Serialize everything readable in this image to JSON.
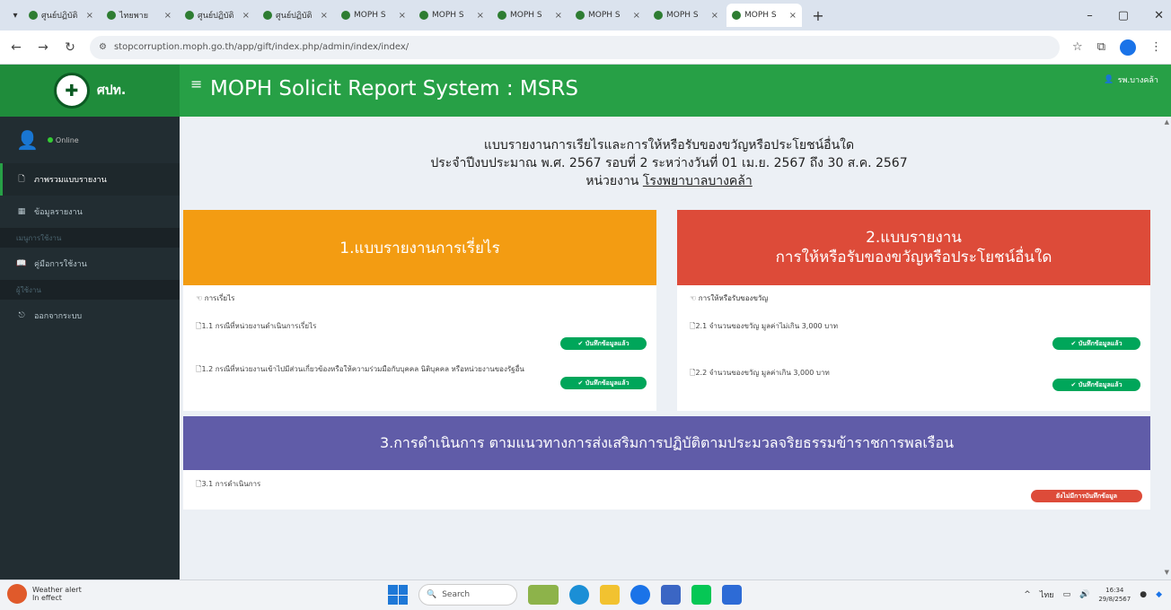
{
  "browser": {
    "tabs": [
      {
        "label": "ศูนย์ปฏิบัติ"
      },
      {
        "label": "ไทยพาย"
      },
      {
        "label": "ศูนย์ปฏิบัติ"
      },
      {
        "label": "ศูนย์ปฏิบัติ"
      },
      {
        "label": "MOPH S"
      },
      {
        "label": "MOPH S"
      },
      {
        "label": "MOPH S"
      },
      {
        "label": "MOPH S"
      },
      {
        "label": "MOPH S"
      },
      {
        "label": "MOPH S"
      }
    ],
    "url": "stopcorruption.moph.go.th/app/gift/index.php/admin/index/index/"
  },
  "app": {
    "logo_text": "ศปท.",
    "title": "MOPH Solicit Report System : MSRS",
    "user_name": "รพ.บางคล้า"
  },
  "sidebar": {
    "status": "Online",
    "items": [
      {
        "label": "ภาพรวมแบบรายงาน",
        "icon": "file-icon"
      },
      {
        "label": "ข้อมูลรายงาน",
        "icon": "table-icon"
      },
      {
        "header": "เมนูการใช้งาน"
      },
      {
        "label": "คู่มือการใช้งาน",
        "icon": "book-icon"
      },
      {
        "header": "ผู้ใช้งาน"
      },
      {
        "label": "ออกจากระบบ",
        "icon": "logout-icon"
      }
    ]
  },
  "header": {
    "line1": "แบบรายงานการเรียไรและการให้หรือรับของขวัญหรือประโยชน์อื่นใด",
    "line2": "ประจำปีงบประมาณ พ.ศ. 2567 รอบที่ 2 ระหว่างวันที่ 01 เม.ย. 2567 ถึง 30 ส.ค. 2567",
    "unit_prefix": "หน่วยงาน",
    "unit_name": "โรงพยาบาลบางคล้า"
  },
  "panels": [
    {
      "title": "1.แบบรายงานการเรี่ยไร",
      "subtitle": "การเรี่ยไร",
      "rows": [
        {
          "text": "1.1 กรณีที่หน่วยงานดำเนินการเรี่ยไร",
          "badge": "บันทึกข้อมูลแล้ว"
        },
        {
          "text": "1.2 กรณีที่หน่วยงานเข้าไปมีส่วนเกี่ยวข้องหรือให้ความร่วมมือกับบุคคล นิติบุคคล หรือหน่วยงานของรัฐอื่น",
          "badge": "บันทึกข้อมูลแล้ว"
        }
      ]
    },
    {
      "title_line1": "2.แบบรายงาน",
      "title_line2": "การให้หรือรับของขวัญหรือประโยชน์อื่นใด",
      "subtitle": "การให้หรือรับของขวัญ",
      "rows": [
        {
          "text": "2.1 จำนวนของขวัญ มูลค่าไม่เกิน 3,000 บาท",
          "badge": "บันทึกข้อมูลแล้ว"
        },
        {
          "text": "2.2 จำนวนของขวัญ มูลค่าเกิน 3,000 บาท",
          "badge": "บันทึกข้อมูลแล้ว"
        }
      ]
    },
    {
      "title": "3.การดำเนินการ ตามแนวทางการส่งเสริมการปฏิบัติตามประมวลจริยธรรมข้าราชการพลเรือน",
      "rows": [
        {
          "text": "3.1 การดำเนินการ",
          "badge": "ยังไม่มีการบันทึกข้อมูล"
        }
      ]
    }
  ],
  "taskbar": {
    "weather_title": "Weather alert",
    "weather_sub": "In effect",
    "search_placeholder": "Search",
    "lang": "ไทย",
    "time": "16:34",
    "date": "29/8/2567"
  },
  "colors": {
    "topbar": "#27a046",
    "sidebar": "#222d32",
    "panel1": "#f39c12",
    "panel2": "#dd4b39",
    "panel3": "#605ca8",
    "badge_ok": "#00a65a",
    "badge_none": "#dd4b39"
  }
}
